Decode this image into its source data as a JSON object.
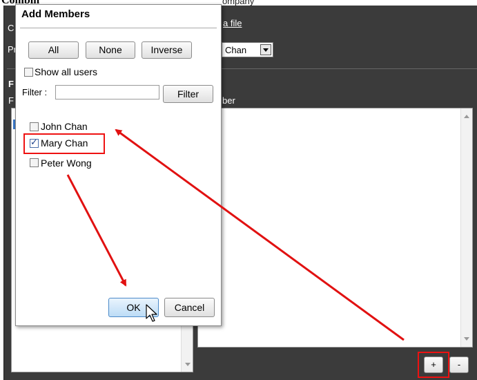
{
  "background": {
    "title_partial": "Combin",
    "company_partial": "ompany",
    "file_link": "a file",
    "label_c": "C",
    "label_pr": "Pr",
    "select_value": "Chan",
    "label_f": "F",
    "label_f2": "F",
    "members_header_partial": "ber",
    "add_button": "+",
    "remove_button": "-"
  },
  "dialog": {
    "title": "Add Members",
    "buttons": {
      "all": "All",
      "none": "None",
      "inverse": "Inverse"
    },
    "show_all_users": {
      "label": "Show all users",
      "checked": false
    },
    "filter": {
      "label": "Filter :",
      "value": "",
      "button": "Filter"
    },
    "users": [
      {
        "name": "John Chan",
        "checked": false
      },
      {
        "name": "Mary Chan",
        "checked": true
      },
      {
        "name": "Peter Wong",
        "checked": false
      }
    ],
    "ok_button": "OK",
    "cancel_button": "Cancel"
  },
  "annotation_color": "#e11111"
}
